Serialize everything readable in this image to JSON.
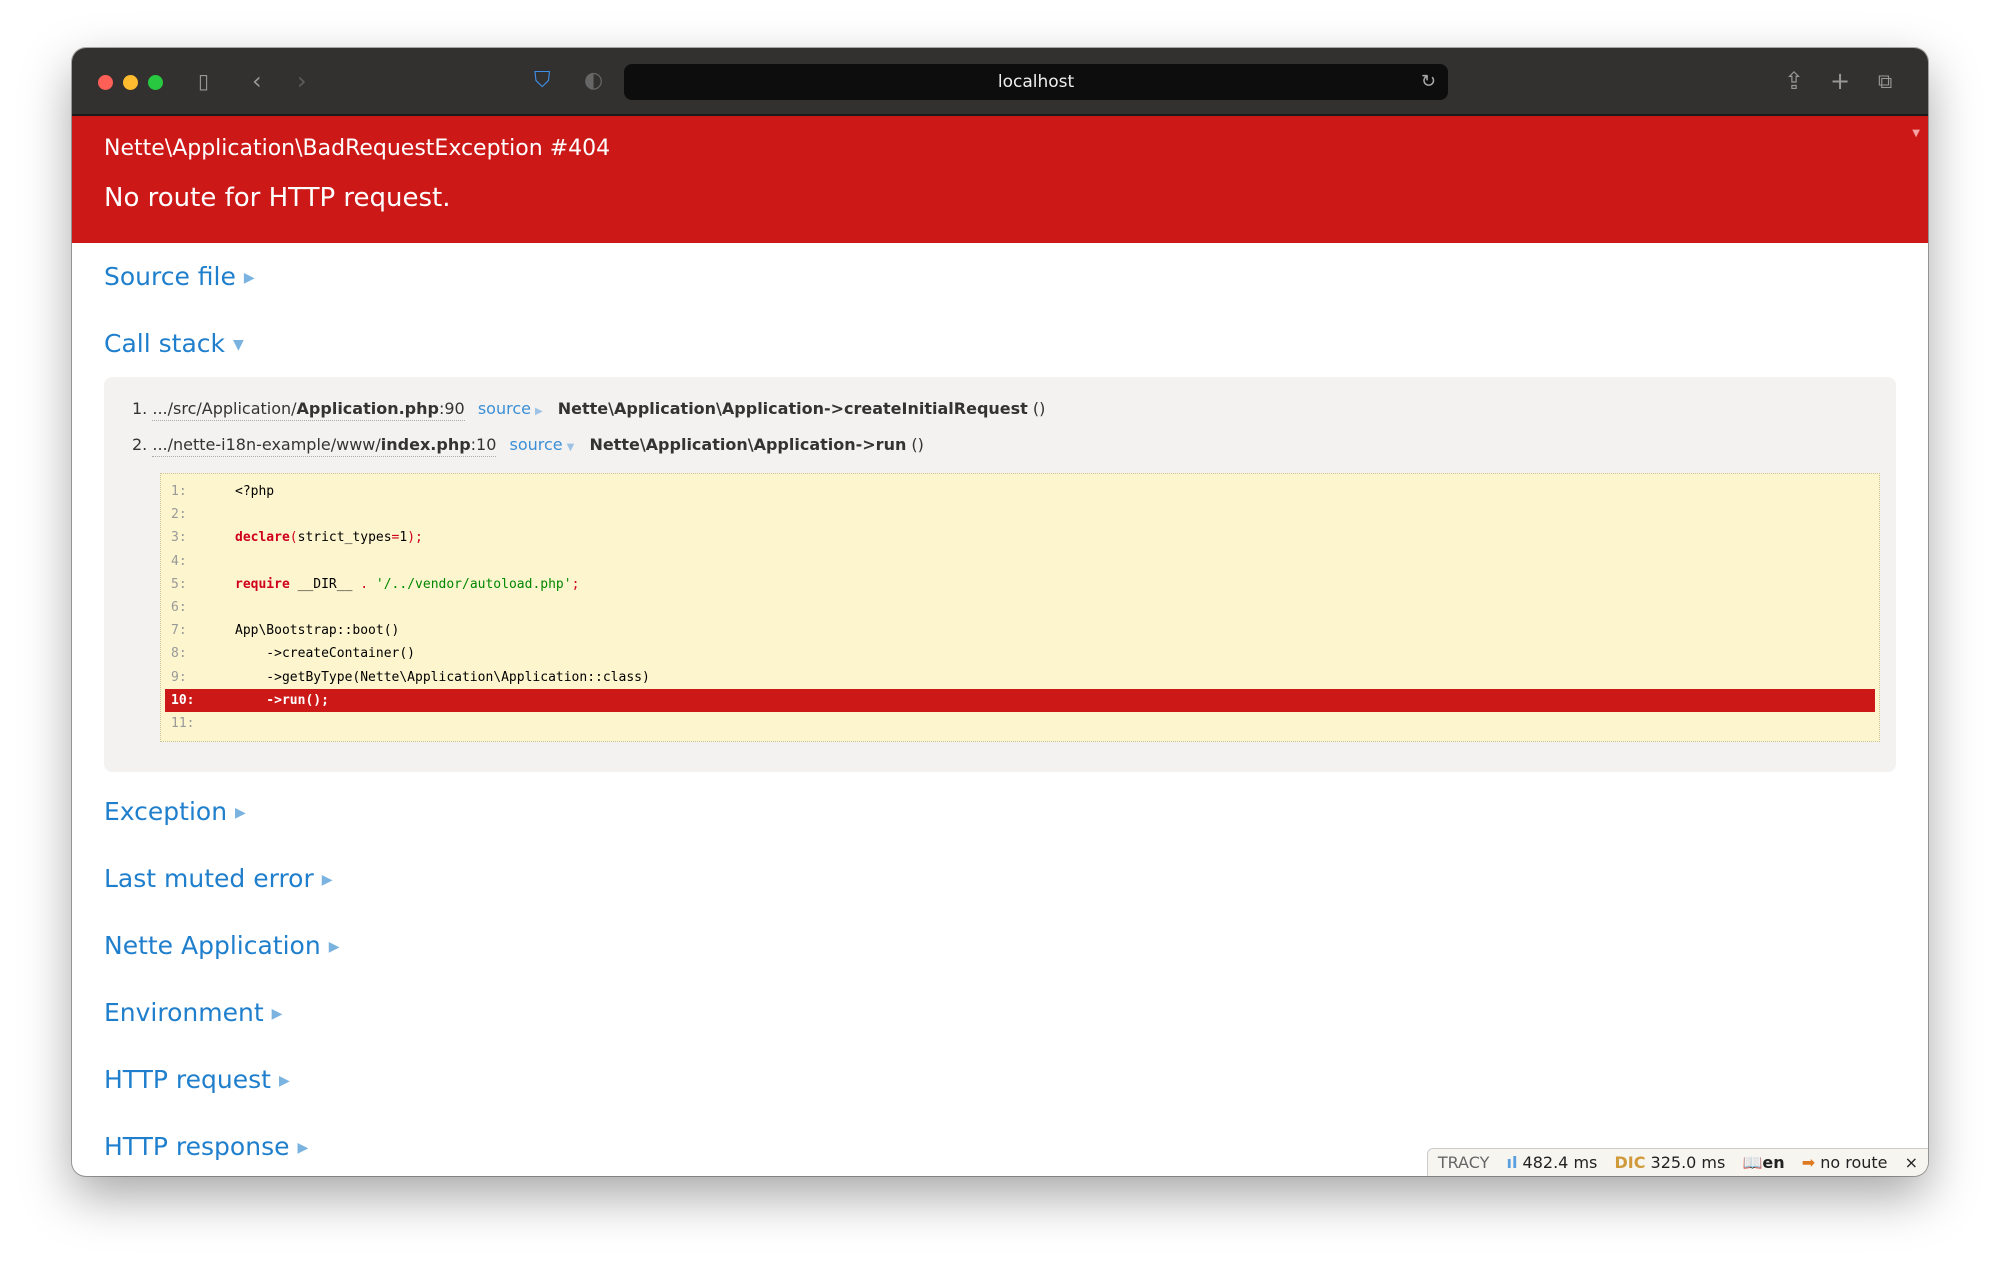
{
  "browser": {
    "url": "localhost"
  },
  "error": {
    "class": "Nette\\Application\\BadRequestException #404",
    "message": "No route for HTTP request."
  },
  "sections": {
    "source_file": "Source file",
    "call_stack": "Call stack",
    "exception": "Exception",
    "last_muted": "Last muted error",
    "nette_app": "Nette Application",
    "environment": "Environment",
    "http_request": "HTTP request",
    "http_response": "HTTP response"
  },
  "stack": [
    {
      "num": "1.",
      "path": ".../src/Application/",
      "file": "Application.php",
      "line": ":90",
      "source": "source",
      "fn": "Nette\\Application\\Application->createInitialRequest",
      "args": " ()"
    },
    {
      "num": "2.",
      "path": ".../nette-i18n-example/www/",
      "file": "index.php",
      "line": ":10",
      "source": "source",
      "fn": "Nette\\Application\\Application->run",
      "args": " ()"
    }
  ],
  "code": [
    "1:",
    "2:",
    "3:",
    "4:",
    "5:",
    "6:",
    "7:",
    "8:",
    "9:",
    "10:",
    "11:"
  ],
  "code_text": {
    "l1": "<?php",
    "l3a": "declare",
    "l3b": "(",
    "l3c": "strict_types",
    "l3d": "=",
    "l3e": "1",
    "l3f": ");",
    "l5a": "require",
    "l5b": " __DIR__ ",
    "l5c": ".",
    "l5d": " '/../vendor/autoload.php'",
    "l5e": ";",
    "l7": "App\\Bootstrap::boot()",
    "l8": "    ->createContainer()",
    "l9": "    ->getByType(Nette\\Application\\Application::class)",
    "l10": "    ->run();"
  },
  "tracy": {
    "label": "TRACY",
    "time": "482.4 ms",
    "dic": "325.0 ms",
    "lang": "en",
    "route": "no route",
    "close": "×"
  },
  "colors": {
    "header": "#cd1818",
    "link": "#1f7fcc",
    "code_bg": "#fdf5ce"
  }
}
